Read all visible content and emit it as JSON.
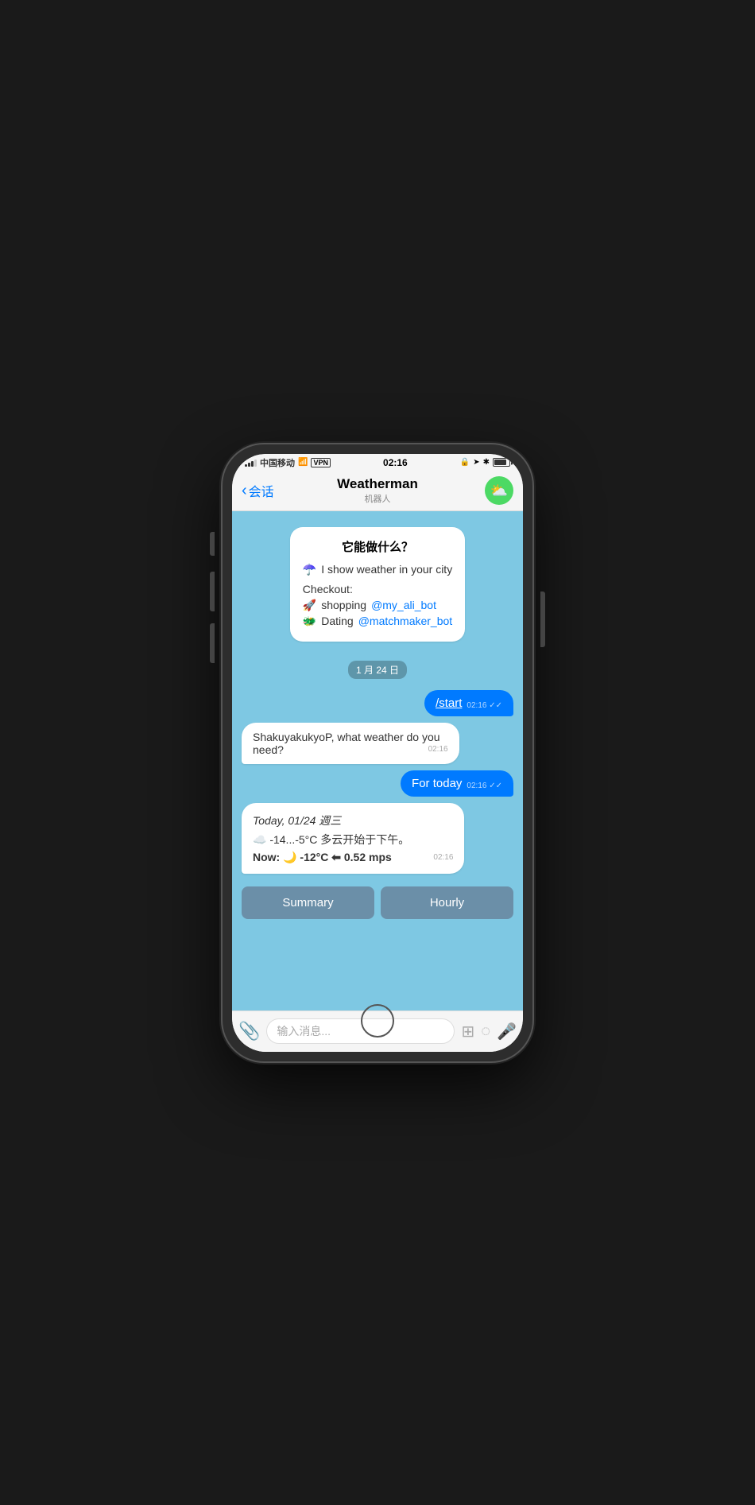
{
  "statusBar": {
    "carrier": "中国移动",
    "wifi": "WiFi",
    "vpn": "VPN",
    "time": "02:16",
    "battery": "100"
  },
  "navBar": {
    "backLabel": "会话",
    "title": "Weatherman",
    "subtitle": "机器人"
  },
  "chat": {
    "welcomeBubble": {
      "title": "它能做什么？",
      "line1": "☂️ I show weather in your city",
      "checkoutTitle": "Checkout:",
      "checkout1": "🚀 shopping @my_ali_bot",
      "checkout2": "🐲 Dating @matchmaker_bot",
      "link1": "@my_ali_bot",
      "link2": "@matchmaker_bot"
    },
    "dateSeparator": "1 月 24 日",
    "userMsg1": {
      "text": "/start",
      "time": "02:16",
      "checks": "✓✓"
    },
    "botReply1": {
      "text": "ShakuyakukyoP, what weather do you need?",
      "time": "02:16"
    },
    "userMsg2": {
      "text": "For today",
      "time": "02:16",
      "checks": "✓✓"
    },
    "weatherBubble": {
      "date": "Today, 01/24 週三",
      "temp": "☁️ -14...-5°C 多云开始于下午。",
      "now": "Now: 🌙 -12°C ⬅ 0.52 mps",
      "time": "02:16"
    },
    "actionButtons": {
      "summary": "Summary",
      "hourly": "Hourly"
    }
  },
  "inputBar": {
    "placeholder": "输入消息..."
  }
}
